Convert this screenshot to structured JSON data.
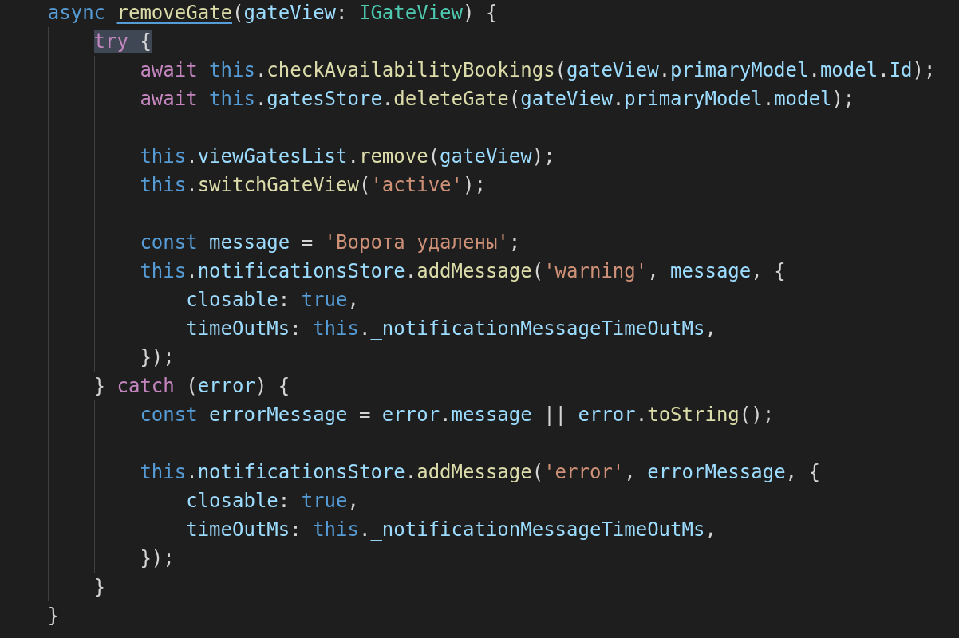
{
  "editor": {
    "lines": [
      {
        "kind": "code",
        "tokens": [
          {
            "text": "async ",
            "kind": "keyword"
          },
          {
            "text": "removeGate",
            "kind": "fn_link"
          },
          {
            "text": "(",
            "kind": "plain"
          },
          {
            "text": "gateView",
            "kind": "var"
          },
          {
            "text": ": ",
            "kind": "plain"
          },
          {
            "text": "IGateView",
            "kind": "type"
          },
          {
            "text": ") {",
            "kind": "plain"
          }
        ],
        "children": [
          {
            "kind": "code",
            "tokens": [
              {
                "text": "try",
                "kind": "control",
                "highlighted": true
              },
              {
                "text": " {",
                "kind": "plain",
                "highlighted": true
              }
            ],
            "children": [
              {
                "kind": "code",
                "tokens": [
                  {
                    "text": "await ",
                    "kind": "control"
                  },
                  {
                    "text": "this",
                    "kind": "keyword"
                  },
                  {
                    "text": ".",
                    "kind": "plain"
                  },
                  {
                    "text": "checkAvailabilityBookings",
                    "kind": "fn"
                  },
                  {
                    "text": "(",
                    "kind": "plain"
                  },
                  {
                    "text": "gateView",
                    "kind": "var"
                  },
                  {
                    "text": ".",
                    "kind": "plain"
                  },
                  {
                    "text": "primaryModel",
                    "kind": "var"
                  },
                  {
                    "text": ".",
                    "kind": "plain"
                  },
                  {
                    "text": "model",
                    "kind": "var"
                  },
                  {
                    "text": ".",
                    "kind": "plain"
                  },
                  {
                    "text": "Id",
                    "kind": "var"
                  },
                  {
                    "text": ");",
                    "kind": "plain"
                  }
                ]
              },
              {
                "kind": "code",
                "tokens": [
                  {
                    "text": "await ",
                    "kind": "control"
                  },
                  {
                    "text": "this",
                    "kind": "keyword"
                  },
                  {
                    "text": ".",
                    "kind": "plain"
                  },
                  {
                    "text": "gatesStore",
                    "kind": "var"
                  },
                  {
                    "text": ".",
                    "kind": "plain"
                  },
                  {
                    "text": "deleteGate",
                    "kind": "fn"
                  },
                  {
                    "text": "(",
                    "kind": "plain"
                  },
                  {
                    "text": "gateView",
                    "kind": "var"
                  },
                  {
                    "text": ".",
                    "kind": "plain"
                  },
                  {
                    "text": "primaryModel",
                    "kind": "var"
                  },
                  {
                    "text": ".",
                    "kind": "plain"
                  },
                  {
                    "text": "model",
                    "kind": "var"
                  },
                  {
                    "text": ");",
                    "kind": "plain"
                  }
                ]
              },
              {
                "kind": "blank"
              },
              {
                "kind": "code",
                "tokens": [
                  {
                    "text": "this",
                    "kind": "keyword"
                  },
                  {
                    "text": ".",
                    "kind": "plain"
                  },
                  {
                    "text": "viewGatesList",
                    "kind": "var"
                  },
                  {
                    "text": ".",
                    "kind": "plain"
                  },
                  {
                    "text": "remove",
                    "kind": "fn"
                  },
                  {
                    "text": "(",
                    "kind": "plain"
                  },
                  {
                    "text": "gateView",
                    "kind": "var"
                  },
                  {
                    "text": ");",
                    "kind": "plain"
                  }
                ]
              },
              {
                "kind": "code",
                "tokens": [
                  {
                    "text": "this",
                    "kind": "keyword"
                  },
                  {
                    "text": ".switchGateView",
                    "kind": "fn_member"
                  },
                  {
                    "text": "(",
                    "kind": "plain"
                  },
                  {
                    "text": "'active'",
                    "kind": "string"
                  },
                  {
                    "text": ");",
                    "kind": "plain"
                  }
                ]
              },
              {
                "kind": "blank"
              },
              {
                "kind": "code",
                "tokens": [
                  {
                    "text": "const ",
                    "kind": "keyword"
                  },
                  {
                    "text": "message",
                    "kind": "var"
                  },
                  {
                    "text": " = ",
                    "kind": "plain"
                  },
                  {
                    "text": "'Ворота удалены'",
                    "kind": "string"
                  },
                  {
                    "text": ";",
                    "kind": "plain"
                  }
                ]
              },
              {
                "kind": "code",
                "tokens": [
                  {
                    "text": "this",
                    "kind": "keyword"
                  },
                  {
                    "text": ".",
                    "kind": "plain"
                  },
                  {
                    "text": "notificationsStore",
                    "kind": "var"
                  },
                  {
                    "text": ".",
                    "kind": "plain"
                  },
                  {
                    "text": "addMessage",
                    "kind": "fn"
                  },
                  {
                    "text": "(",
                    "kind": "plain"
                  },
                  {
                    "text": "'warning'",
                    "kind": "string"
                  },
                  {
                    "text": ", ",
                    "kind": "plain"
                  },
                  {
                    "text": "message",
                    "kind": "var"
                  },
                  {
                    "text": ", {",
                    "kind": "plain"
                  }
                ],
                "children": [
                  {
                    "kind": "code",
                    "tokens": [
                      {
                        "text": "closable",
                        "kind": "var"
                      },
                      {
                        "text": ": ",
                        "kind": "plain"
                      },
                      {
                        "text": "true",
                        "kind": "keyword"
                      },
                      {
                        "text": ",",
                        "kind": "plain"
                      }
                    ]
                  },
                  {
                    "kind": "code",
                    "tokens": [
                      {
                        "text": "timeOutMs",
                        "kind": "var"
                      },
                      {
                        "text": ": ",
                        "kind": "plain"
                      },
                      {
                        "text": "this",
                        "kind": "keyword"
                      },
                      {
                        "text": ".",
                        "kind": "plain"
                      },
                      {
                        "text": "_notificationMessageTimeOutMs",
                        "kind": "var"
                      },
                      {
                        "text": ",",
                        "kind": "plain"
                      }
                    ]
                  }
                ]
              },
              {
                "kind": "code",
                "tokens": [
                  {
                    "text": "});",
                    "kind": "plain"
                  }
                ]
              }
            ]
          },
          {
            "kind": "code",
            "tokens": [
              {
                "text": "} ",
                "kind": "plain"
              },
              {
                "text": "catch",
                "kind": "control"
              },
              {
                "text": " (",
                "kind": "plain"
              },
              {
                "text": "error",
                "kind": "var"
              },
              {
                "text": ") {",
                "kind": "plain"
              }
            ],
            "children": [
              {
                "kind": "code",
                "tokens": [
                  {
                    "text": "const ",
                    "kind": "keyword"
                  },
                  {
                    "text": "errorMessage",
                    "kind": "var"
                  },
                  {
                    "text": " = ",
                    "kind": "plain"
                  },
                  {
                    "text": "error",
                    "kind": "var"
                  },
                  {
                    "text": ".",
                    "kind": "plain"
                  },
                  {
                    "text": "message",
                    "kind": "var"
                  },
                  {
                    "text": " || ",
                    "kind": "plain"
                  },
                  {
                    "text": "error",
                    "kind": "var"
                  },
                  {
                    "text": ".",
                    "kind": "plain"
                  },
                  {
                    "text": "toString",
                    "kind": "fn"
                  },
                  {
                    "text": "();",
                    "kind": "plain"
                  }
                ]
              },
              {
                "kind": "blank"
              },
              {
                "kind": "code",
                "tokens": [
                  {
                    "text": "this",
                    "kind": "keyword"
                  },
                  {
                    "text": ".",
                    "kind": "plain"
                  },
                  {
                    "text": "notificationsStore",
                    "kind": "var"
                  },
                  {
                    "text": ".",
                    "kind": "plain"
                  },
                  {
                    "text": "addMessage",
                    "kind": "fn"
                  },
                  {
                    "text": "(",
                    "kind": "plain"
                  },
                  {
                    "text": "'error'",
                    "kind": "string"
                  },
                  {
                    "text": ", ",
                    "kind": "plain"
                  },
                  {
                    "text": "errorMessage",
                    "kind": "var"
                  },
                  {
                    "text": ", {",
                    "kind": "plain"
                  }
                ],
                "children": [
                  {
                    "kind": "code",
                    "tokens": [
                      {
                        "text": "closable",
                        "kind": "var"
                      },
                      {
                        "text": ": ",
                        "kind": "plain"
                      },
                      {
                        "text": "true",
                        "kind": "keyword"
                      },
                      {
                        "text": ",",
                        "kind": "plain"
                      }
                    ]
                  },
                  {
                    "kind": "code",
                    "tokens": [
                      {
                        "text": "timeOutMs",
                        "kind": "var"
                      },
                      {
                        "text": ": ",
                        "kind": "plain"
                      },
                      {
                        "text": "this",
                        "kind": "keyword"
                      },
                      {
                        "text": ".",
                        "kind": "plain"
                      },
                      {
                        "text": "_notificationMessageTimeOutMs",
                        "kind": "var"
                      },
                      {
                        "text": ",",
                        "kind": "plain"
                      }
                    ]
                  }
                ]
              },
              {
                "kind": "code",
                "tokens": [
                  {
                    "text": "});",
                    "kind": "plain"
                  }
                ]
              }
            ]
          },
          {
            "kind": "code",
            "tokens": [
              {
                "text": "}",
                "kind": "plain"
              }
            ]
          }
        ]
      },
      {
        "kind": "code",
        "tokens": [
          {
            "text": "}",
            "kind": "plain"
          }
        ]
      }
    ]
  }
}
